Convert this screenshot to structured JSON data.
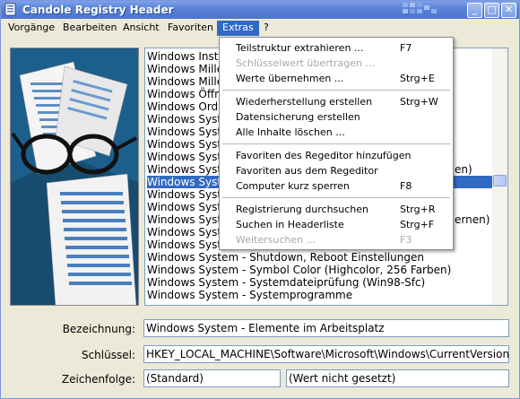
{
  "window": {
    "title": "Candole Registry Header"
  },
  "menubar": {
    "items": [
      {
        "label": "Vorgänge"
      },
      {
        "label": "Bearbeiten"
      },
      {
        "label": "Ansicht"
      },
      {
        "label": "Favoriten"
      },
      {
        "label": "Extras"
      },
      {
        "label": "?"
      }
    ]
  },
  "titlebar_buttons": {
    "minimize": "_",
    "maximize": "□",
    "close": "✕"
  },
  "list": {
    "items": [
      "Windows Insta",
      "Windows Miller",
      "Windows Miller",
      "Windows Öffn",
      "Windows Ordn",
      "Windows Syster",
      "Windows Syster",
      "Windows Syster",
      "Windows Syster",
      "Windows Syster",
      "Windows Syster",
      "Windows Syster",
      "Windows Syster",
      "Windows Syster",
      "Windows Syster",
      "Windows Syster",
      "Windows System - Shutdown, Reboot Einstellungen",
      "Windows System - Symbol Color (Highcolor, 256 Farben)",
      "Windows System - Systemdateiprüfung (Win98-Sfc)",
      "Windows System - Systemprogramme"
    ],
    "partial_right_1": "en)",
    "partial_right_2": "ernen)",
    "selected_index": 10
  },
  "fields": {
    "bezeichnung_label": "Bezeichnung:",
    "bezeichnung_value": "Windows System - Elemente im Arbeitsplatz",
    "schluessel_label": "Schlüssel:",
    "schluessel_value": "HKEY_LOCAL_MACHINE\\Software\\Microsoft\\Windows\\CurrentVersion\\exp",
    "zeichenfolge_label": "Zeichenfolge:",
    "zeichenfolge_value": "(Standard)",
    "wert_value": "(Wert nicht gesetzt)"
  },
  "extras_menu": {
    "items": [
      {
        "label": "Teilstruktur extrahieren ...",
        "shortcut": "F7",
        "disabled": false
      },
      {
        "label": "Schlüsselwert übertragen ...",
        "shortcut": "",
        "disabled": true
      },
      {
        "label": "Werte übernehmen ...",
        "shortcut": "Strg+E",
        "disabled": false
      },
      {
        "label": "Wiederherstellung erstellen",
        "shortcut": "Strg+W",
        "disabled": false
      },
      {
        "label": "Datensicherung erstellen",
        "shortcut": "",
        "disabled": false
      },
      {
        "label": "Alle Inhalte löschen ...",
        "shortcut": "",
        "disabled": false
      },
      {
        "label": "Favoriten des Regeditor hinzufügen",
        "shortcut": "",
        "disabled": false
      },
      {
        "label": "Favoriten aus dem Regeditor",
        "shortcut": "",
        "disabled": false
      },
      {
        "label": "Computer kurz sperren",
        "shortcut": "F8",
        "disabled": false
      },
      {
        "label": "Registrierung durchsuchen",
        "shortcut": "Strg+R",
        "disabled": false
      },
      {
        "label": "Suchen in Headerliste",
        "shortcut": "Strg+F",
        "disabled": false
      },
      {
        "label": "Weitersuchen ...",
        "shortcut": "F3",
        "disabled": true
      }
    ]
  },
  "colors": {
    "title_gradient": "#5b83d8",
    "selection": "#316ac5",
    "disabled_text": "#a8a8a8"
  },
  "icons": {
    "app": "registry-app-icon",
    "image": "glasses-documents-illustration"
  }
}
